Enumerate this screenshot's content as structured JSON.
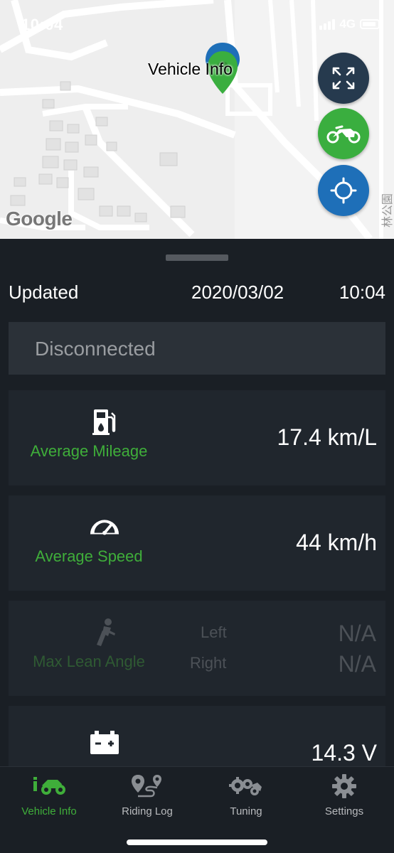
{
  "status_bar": {
    "time": "10:04",
    "network": "4G"
  },
  "map": {
    "marker_label": "Vehicle Info",
    "attribution": "Google",
    "street_label": "林公園",
    "buttons": [
      {
        "name": "fullscreen",
        "icon": "expand-icon",
        "color": "#263a4e"
      },
      {
        "name": "vehicle",
        "icon": "motorcycle-icon",
        "color": "#3aae3f"
      },
      {
        "name": "locate",
        "icon": "crosshair-icon",
        "color": "#1e6fb8"
      }
    ]
  },
  "panel": {
    "updated_label": "Updated",
    "updated_date": "2020/03/02",
    "updated_time": "10:04",
    "connection_status": "Disconnected"
  },
  "cards": {
    "mileage": {
      "label": "Average Mileage",
      "value": "17.4 km/L",
      "icon": "fuel-pump-icon"
    },
    "speed": {
      "label": "Average Speed",
      "value": "44 km/h",
      "icon": "speedometer-icon"
    },
    "lean": {
      "label": "Max Lean Angle",
      "left_label": "Left",
      "left_value": "N/A",
      "right_label": "Right",
      "right_value": "N/A",
      "icon": "lean-rider-icon"
    },
    "battery": {
      "value": "14.3 V",
      "icon": "battery-icon"
    }
  },
  "tabs": [
    {
      "label": "Vehicle Info",
      "icon": "vehicle-info-icon",
      "active": true
    },
    {
      "label": "Riding Log",
      "icon": "route-icon",
      "active": false
    },
    {
      "label": "Tuning",
      "icon": "gears-motorcycle-icon",
      "active": false
    },
    {
      "label": "Settings",
      "icon": "gear-icon",
      "active": false
    }
  ],
  "colors": {
    "accent_green": "#3fae3a",
    "panel_bg": "#1a1f25",
    "card_bg": "#20262d"
  }
}
